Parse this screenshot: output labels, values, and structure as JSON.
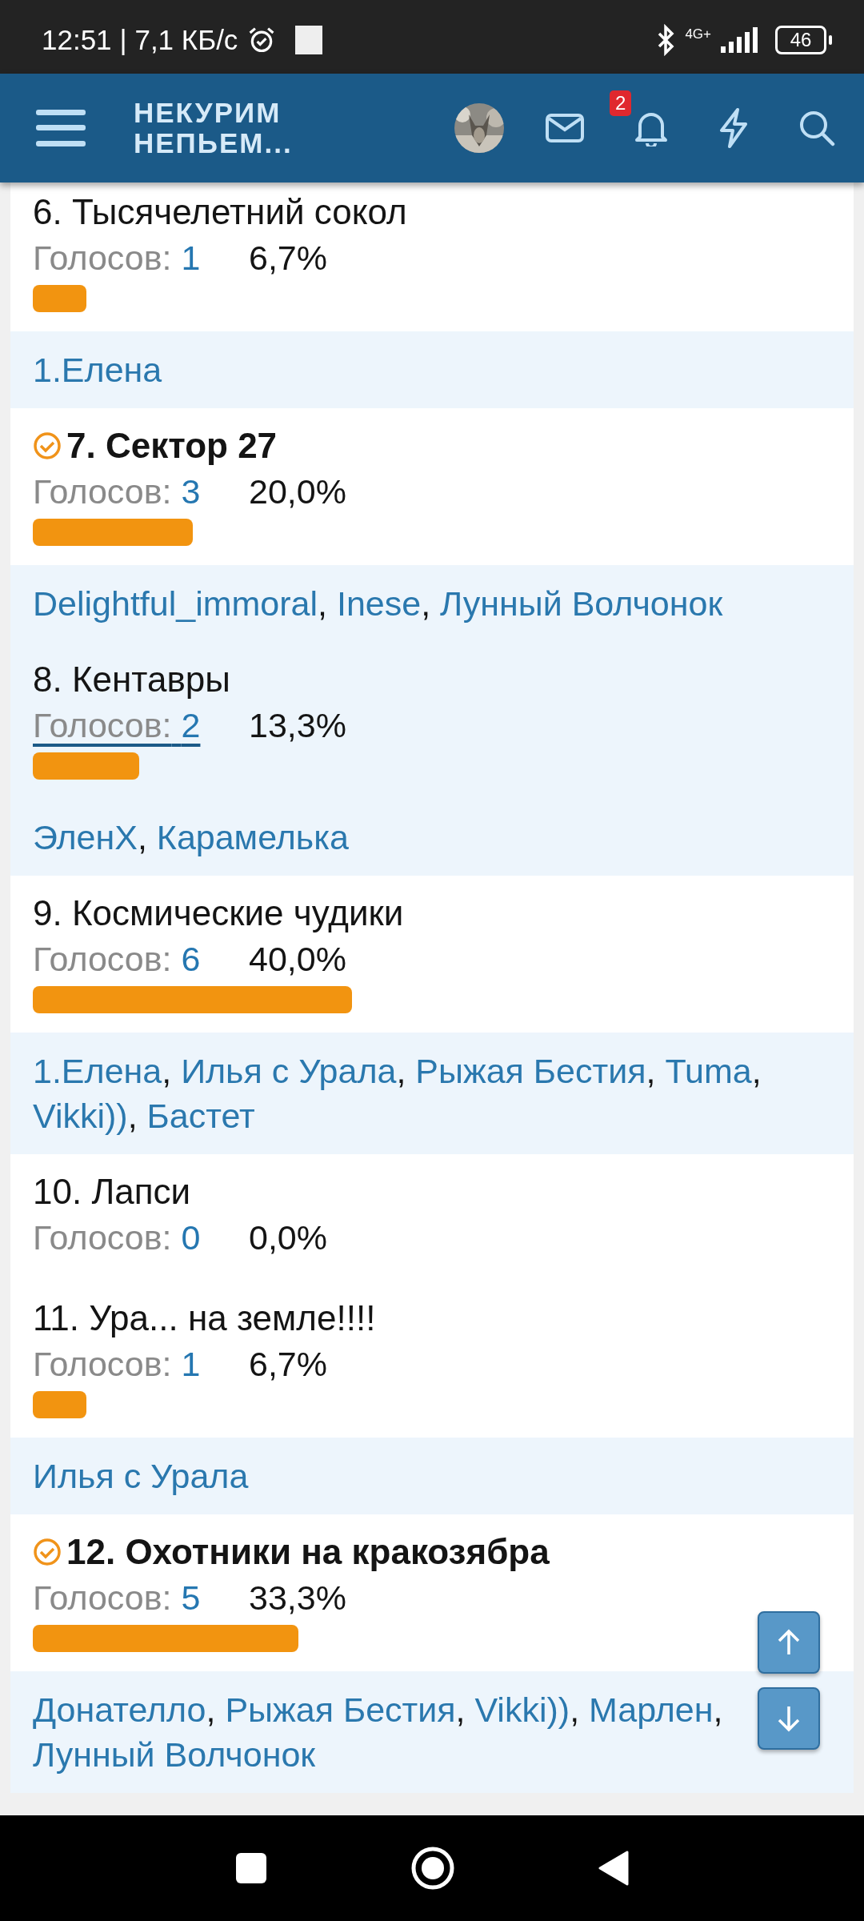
{
  "status_bar": {
    "time": "12:51",
    "speed": "| 7,1 КБ/с",
    "network": "4G+",
    "battery": "46"
  },
  "header": {
    "logo_lines": [
      "НЕКУРИМ",
      "НЕПЬЕМ..."
    ],
    "notification_count": "2"
  },
  "poll_items": [
    {
      "title": "6. Тысячелетний сокол",
      "votes_label": "Голосов:",
      "votes": "1",
      "percent": "6,7%",
      "checked": false,
      "hovered": false,
      "voters": [
        "1.Елена"
      ]
    },
    {
      "title": "7. Сектор 27",
      "votes_label": "Голосов:",
      "votes": "3",
      "percent": "20,0%",
      "checked": true,
      "hovered": false,
      "separator": ",",
      "voters": [
        "Delightful_immoral",
        "Inese",
        "Лунный Волчонок"
      ]
    },
    {
      "title": "8. Кентавры",
      "votes_label": "Голосов:",
      "votes": "2",
      "percent": "13,3%",
      "checked": false,
      "hovered": true,
      "separator": ",",
      "voters": [
        "ЭленХ",
        "Карамелька"
      ]
    },
    {
      "title": "9. Космические чудики",
      "votes_label": "Голосов:",
      "votes": "6",
      "percent": "40,0%",
      "checked": false,
      "hovered": false,
      "separator": ",",
      "voters": [
        "1.Елена",
        "Илья с Урала",
        "Рыжая Бестия",
        "Tuma",
        "Vikki))",
        "Бастет"
      ]
    },
    {
      "title": "10. Лапси",
      "votes_label": "Голосов:",
      "votes": "0",
      "percent": "0,0%",
      "checked": false,
      "hovered": false
    },
    {
      "title": "11. Ура... на земле!!!!",
      "votes_label": "Голосов:",
      "votes": "1",
      "percent": "6,7%",
      "checked": false,
      "hovered": false,
      "voters": [
        "Илья с Урала"
      ]
    },
    {
      "title": "12. Охотники на кракозябра",
      "votes_label": "Голосов:",
      "votes": "5",
      "percent": "33,3%",
      "checked": true,
      "hovered": false,
      "separator": ",",
      "voters": [
        "Донателло",
        "Рыжая Бестия",
        "Vikki))",
        "Марлен",
        "Лунный Волчонок"
      ]
    }
  ]
}
